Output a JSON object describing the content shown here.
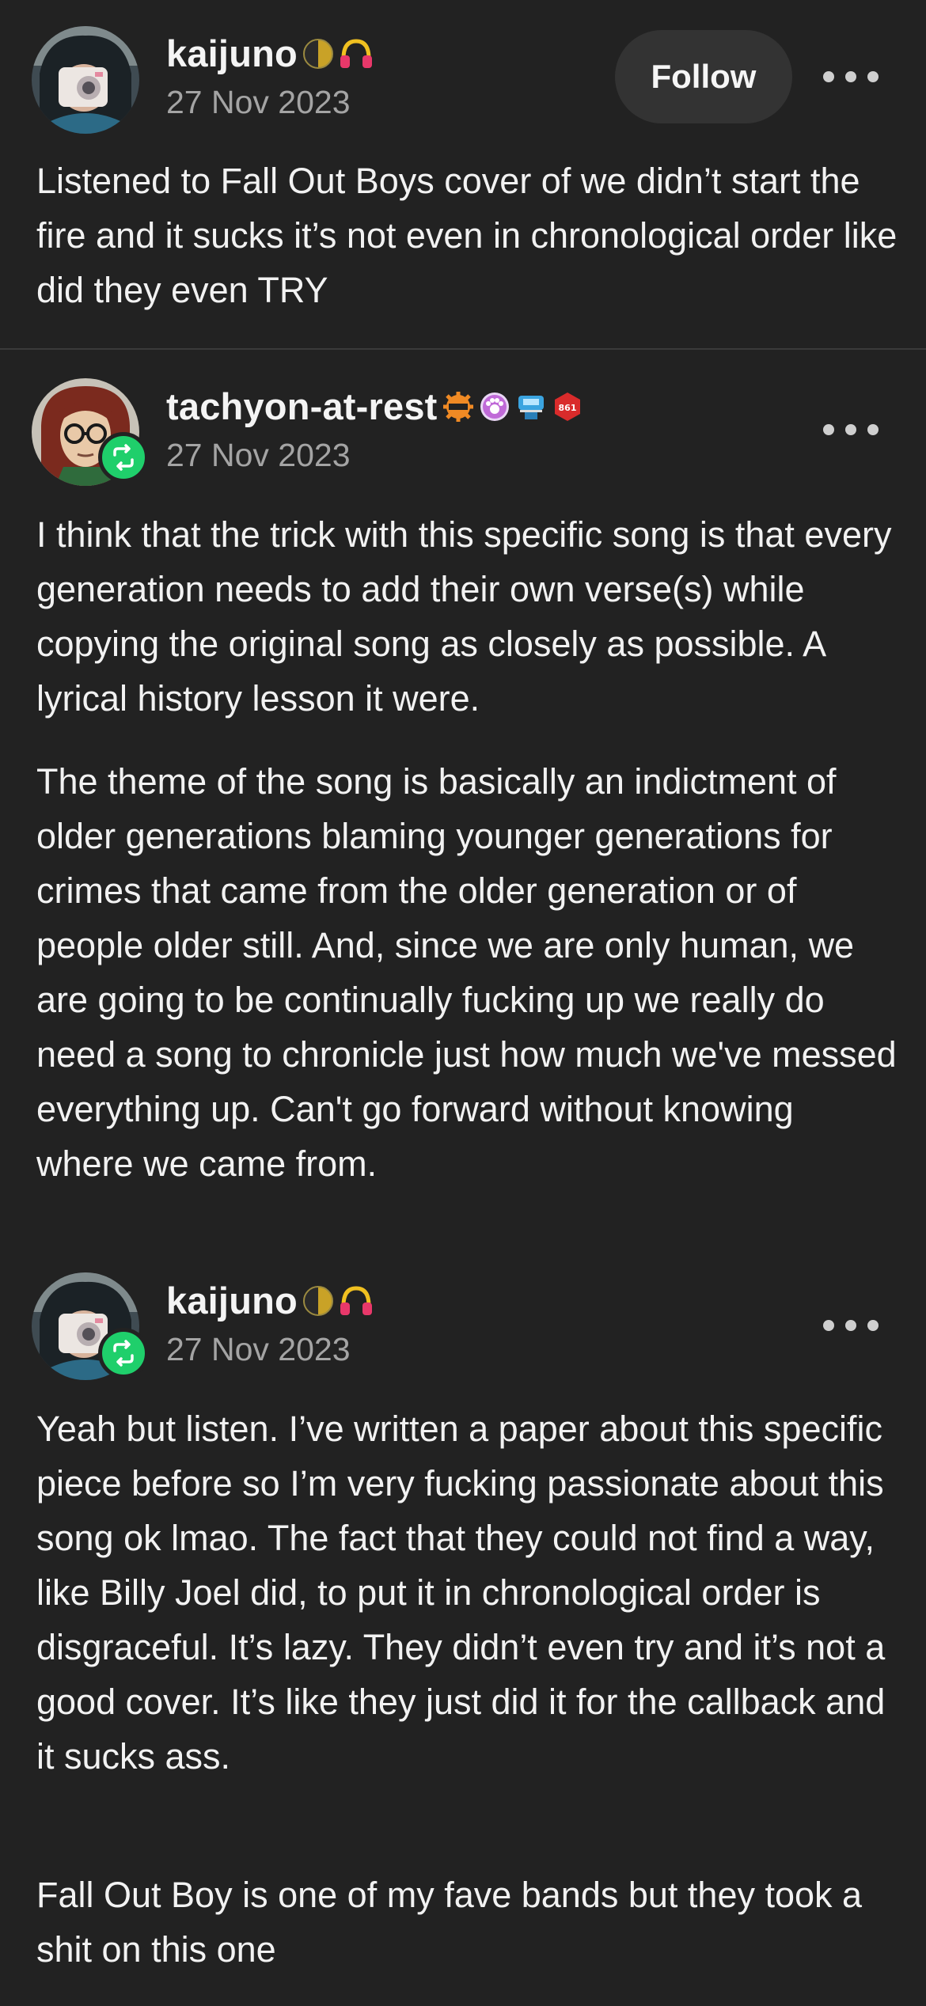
{
  "posts": [
    {
      "username": "kaijuno",
      "date": "27 Nov 2023",
      "follow_label": "Follow",
      "badges": [
        "moon-badge",
        "headphones-badge"
      ],
      "paragraphs": [
        "Listened to Fall Out Boys cover of we didn’t start the fire and it sucks it’s not even in chronological order like did they even TRY"
      ]
    },
    {
      "username": "tachyon-at-rest",
      "date": "27 Nov 2023",
      "badges": [
        "orange-gear-badge",
        "pink-paw-badge",
        "blue-robot-badge",
        "red-hexagon-badge"
      ],
      "paragraphs": [
        "I think that the trick with this specific song is that every generation needs to add their own verse(s) while copying the original song as closely as possible. A lyrical history lesson it were.",
        "The theme of the song is basically an indictment of older generations blaming younger generations for crimes that came from the older generation or of people older still. And, since we are only human, we are going to be continually fucking up we really do need a song to chronicle just how much we've messed everything up. Can't go forward without knowing where we came from."
      ]
    },
    {
      "username": "kaijuno",
      "date": "27 Nov 2023",
      "badges": [
        "moon-badge",
        "headphones-badge"
      ],
      "paragraphs": [
        "Yeah but listen. I’ve written a paper about this specific piece before so I’m very fucking passionate about this song ok lmao. The fact that they could not find a way, like Billy Joel did, to put it in chronological order is disgraceful. It’s lazy. They didn’t even try and it’s not a good cover. It’s like they just did it for the callback and it sucks ass.",
        "Fall Out Boy is one of my fave bands but they took a shit on this one"
      ]
    }
  ],
  "colors": {
    "background": "#222222",
    "reblog_badge": "#1fcf6b",
    "date_text": "#a4a4a4",
    "follow_button_bg": "#333333"
  }
}
